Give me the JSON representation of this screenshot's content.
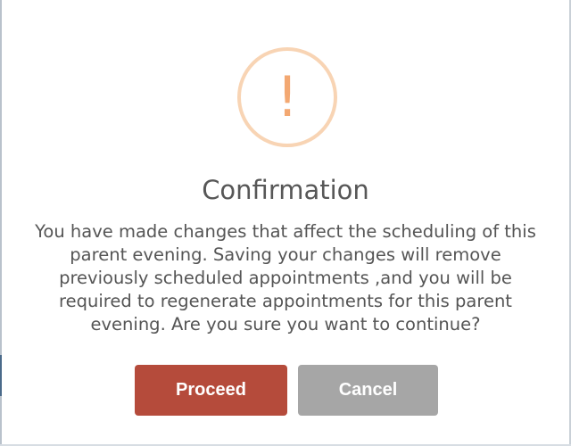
{
  "dialog": {
    "icon": "exclamation-icon",
    "title": "Confirmation",
    "message": "You have made changes that affect the scheduling of this parent evening. Saving your changes will remove previously scheduled appointments ,and you will be required to regenerate appointments for this parent evening. Are you sure you want to continue?",
    "buttons": {
      "proceed_label": "Proceed",
      "cancel_label": "Cancel"
    }
  },
  "colors": {
    "proceed_button": "#b54b3b",
    "cancel_button": "#a6a6a6",
    "warning_ring": "#f8d4b4",
    "warning_glyph": "#f3a872",
    "title_text": "#575757",
    "body_text": "#555555"
  }
}
